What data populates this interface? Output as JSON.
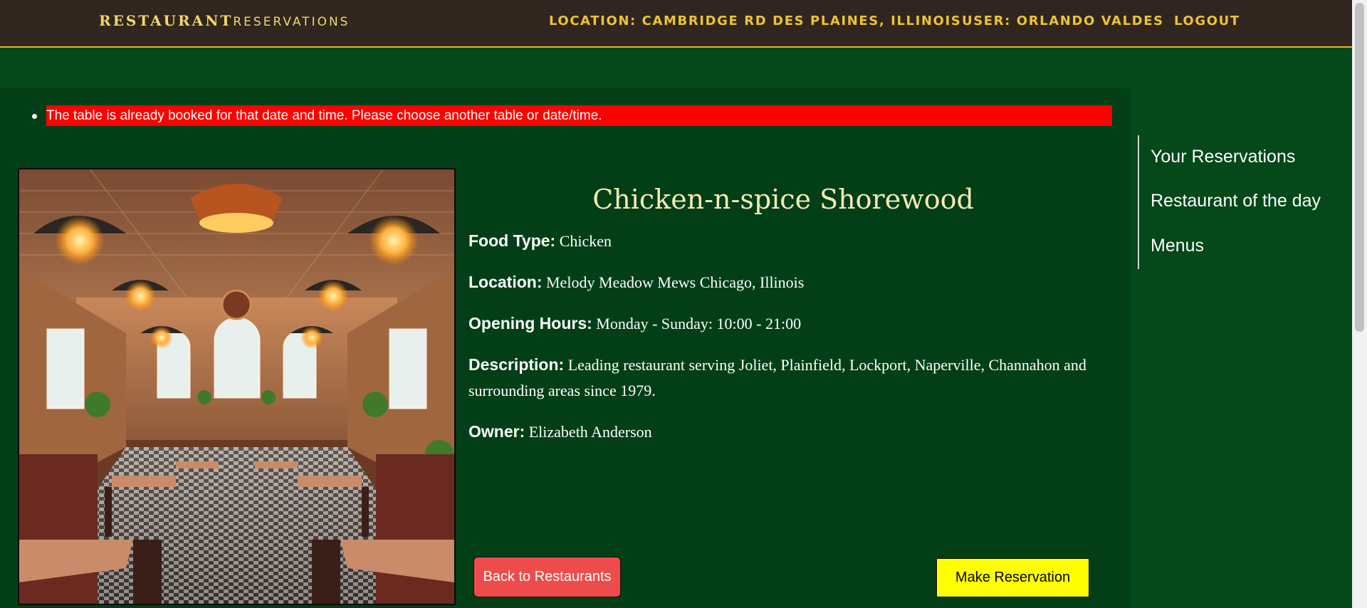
{
  "header": {
    "brand_strong": "RESTAURANT",
    "brand_light": "RESERVATIONS",
    "location": "LOCATION: CAMBRIDGE RD DES PLAINES, ILLINOIS",
    "user": "USER: ORLANDO VALDES",
    "logout": "LOGOUT"
  },
  "alert": {
    "message": "The table is already booked for that date and time. Please choose another table or date/time."
  },
  "restaurant": {
    "name": "Chicken-n-spice Shorewood",
    "food_type_label": "Food Type:",
    "food_type": "Chicken",
    "location_label": "Location:",
    "location": "Melody Meadow Mews Chicago, Illinois",
    "hours_label": "Opening Hours:",
    "hours": "Monday - Sunday: 10:00 - 21:00",
    "description_label": "Description:",
    "description": "Leading restaurant serving Joliet, Plainfield, Lockport, Naperville, Channahon and surrounding areas since 1979.",
    "owner_label": "Owner:",
    "owner": "Elizabeth Anderson"
  },
  "buttons": {
    "back": "Back to Restaurants",
    "reserve": "Make Reservation"
  },
  "sidebar": {
    "items": [
      {
        "label": "Your Reservations"
      },
      {
        "label": "Restaurant of the day"
      },
      {
        "label": "Menus"
      }
    ]
  },
  "colors": {
    "page_bg": "#054819",
    "panel_bg": "#023f17",
    "topbar_bg": "#30261f",
    "nav_text": "#ecc334",
    "alert_bg": "#ff0000",
    "reserve_btn": "#ffff00",
    "back_btn": "#ee4c4c"
  }
}
